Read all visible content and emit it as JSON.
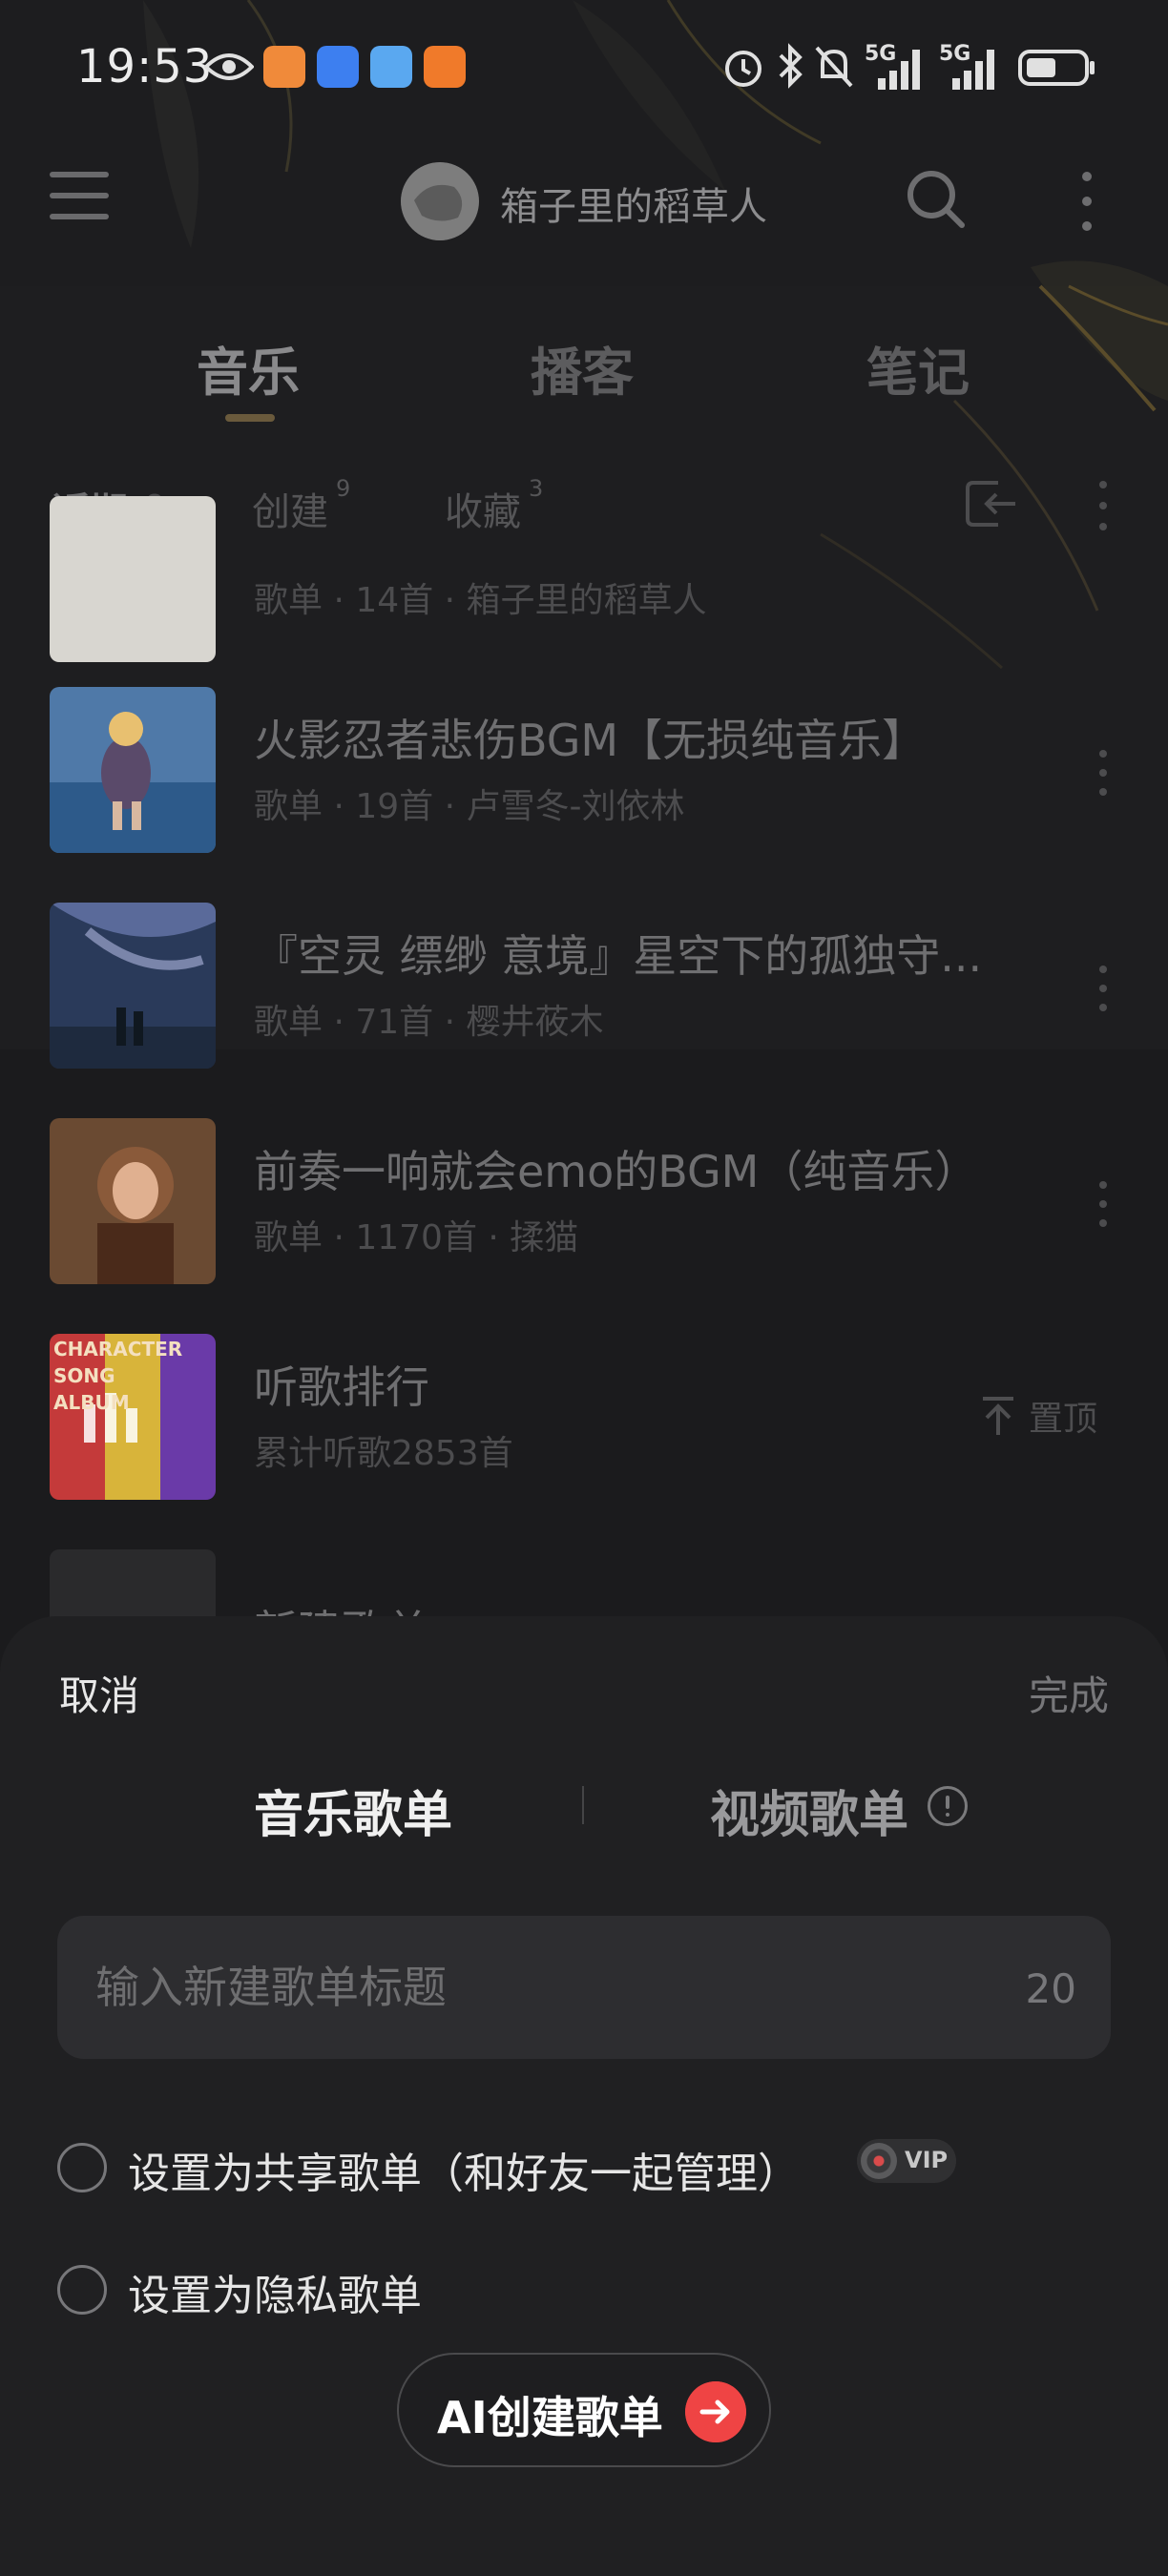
{
  "status_bar": {
    "time": "19:53",
    "network_1": "5G",
    "network_2": "5G"
  },
  "header": {
    "username": "箱子里的稻草人"
  },
  "main_tabs": [
    {
      "label": "音乐",
      "active": true
    },
    {
      "label": "播客",
      "active": false
    },
    {
      "label": "笔记",
      "active": false
    }
  ],
  "sub_tabs": {
    "recent": "近期",
    "created": "创建",
    "created_count": "9",
    "favorites": "收藏",
    "favorites_count": "3"
  },
  "playlists": [
    {
      "title": "",
      "subtitle": "歌单 · 14首 · 箱子里的稻草人"
    },
    {
      "title": "火影忍者悲伤BGM【无损纯音乐】",
      "subtitle": "歌单 · 19首 · 卢雪冬-刘依林"
    },
    {
      "title": "『空灵 缥缈 意境』星空下的孤独守...",
      "subtitle": "歌单 · 71首 · 樱井莜木"
    },
    {
      "title": "前奏一响就会emo的BGM（纯音乐）",
      "subtitle": "歌单 · 1170首 · 揉猫"
    },
    {
      "title": "听歌排行",
      "subtitle": "累计听歌2853首",
      "action": "置顶"
    },
    {
      "title": "新建歌单",
      "subtitle": ""
    }
  ],
  "cover_text": {
    "ranking_line1": "CHARACTER",
    "ranking_line2": "SONG",
    "ranking_line3": "ALBUM"
  },
  "sheet": {
    "cancel": "取消",
    "done": "完成",
    "segment_music": "音乐歌单",
    "segment_video": "视频歌单",
    "title_placeholder": "输入新建歌单标题",
    "char_limit": "20",
    "share_option": "设置为共享歌单（和好友一起管理）",
    "vip_badge": "VIP",
    "private_option": "设置为隐私歌单",
    "ai_button": "AI创建歌单"
  },
  "colors": {
    "accent_red": "#ef4444",
    "sheet_bg": "#202022",
    "page_bg": "#1b1b1d"
  }
}
